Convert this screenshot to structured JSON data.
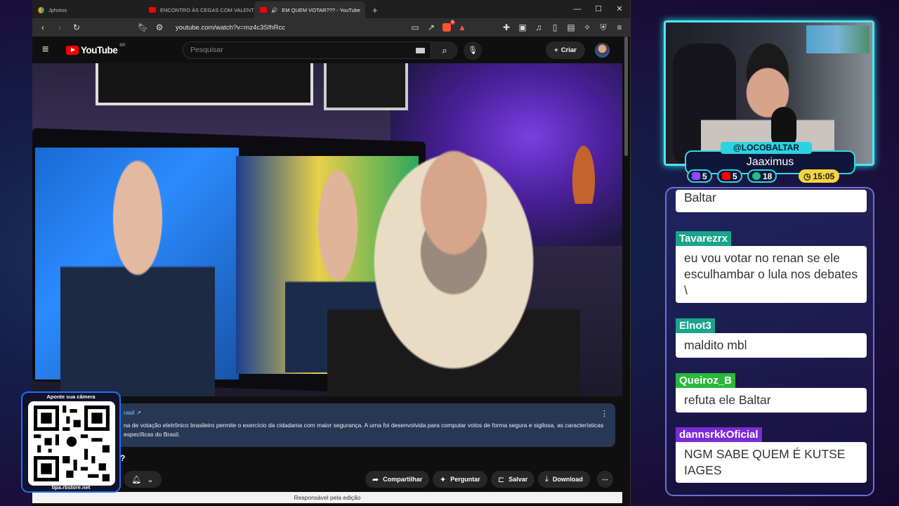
{
  "browser": {
    "tabs": [
      {
        "label": "Jphotos",
        "favicon": "photos"
      },
      {
        "label": "ENCONTRO ÀS CEGAS COM VALENTINA BA",
        "favicon": "yt"
      },
      {
        "label": "EM QUEM VOTAR??? - YouTube",
        "favicon": "yt",
        "audio": "🔊"
      }
    ],
    "new_tab": "+",
    "window_controls": {
      "minimize": "—",
      "maximize": "☐",
      "close": "✕"
    },
    "url": "youtube.com/watch?v=mz4c3SfhRcc",
    "brave_badge": "6"
  },
  "youtube": {
    "logo_text": "YouTube",
    "logo_region": "BR",
    "search_placeholder": "Pesquisar",
    "create_label": "Criar",
    "description": {
      "source": "rasil ↗",
      "text": "na de votação eletrônico brasileiro permite o exercício da cidadania com maior segurança. A urna foi desenvolvida para computar votos de forma segura e sigilosa, as características específicas do Brasil."
    },
    "title_fragment": "?",
    "actions": {
      "share": "Compartilhar",
      "ask": "Perguntar",
      "save": "Salvar",
      "download": "Download"
    },
    "footer_text": "Responsável pela edição"
  },
  "qr": {
    "top_text": "Aponte sua câmera",
    "bottom_text": "tipa.rbstore.net"
  },
  "streamer": {
    "handle": "@LOCOBALTAR",
    "name": "Jaaximus",
    "stats": [
      {
        "value": "5",
        "color": "#9146ff"
      },
      {
        "value": "5",
        "color": "#ff0000"
      },
      {
        "value": "18",
        "color": "#1ec28b"
      }
    ],
    "time": "15:05"
  },
  "chat": {
    "messages": [
      {
        "user": "",
        "text": "Baltar",
        "color": ""
      },
      {
        "user": "Tavarezrx",
        "text": "eu vou votar no renan se ele esculhambar o lula nos debates \\",
        "color": "#18a58a"
      },
      {
        "user": "Elnot3",
        "text": "maldito mbl",
        "color": "#18a58a"
      },
      {
        "user": "Queiroz_B",
        "text": "refuta ele Baltar",
        "color": "#2ab83a"
      },
      {
        "user": "dannsrkkOficial",
        "text": "NGM SABE QUEM É KUTSE IAGES",
        "color": "#7b2bd6"
      }
    ]
  }
}
